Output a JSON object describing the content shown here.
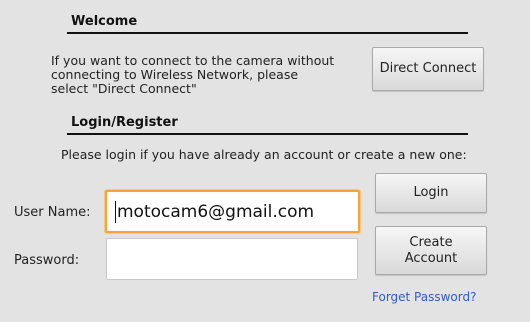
{
  "welcome": {
    "title": "Welcome",
    "description_lines": [
      "If you want to connect to the camera without",
      "connecting to Wireless Network, please",
      "select \"Direct Connect\""
    ],
    "direct_connect_label": "Direct Connect"
  },
  "login": {
    "title": "Login/Register",
    "instruction": "Please login if you have already an account or create a new one:",
    "username_label": "User Name:",
    "username_value": "motocam6@gmail.com",
    "password_label": "Password:",
    "password_value": "",
    "login_label": "Login",
    "create_account_lines": [
      "Create",
      "Account"
    ],
    "forgot_password_label": "Forget Password?"
  },
  "colors": {
    "background": "#e3e3e3",
    "focus_border": "#f3a53a",
    "link": "#2d5fc4"
  }
}
